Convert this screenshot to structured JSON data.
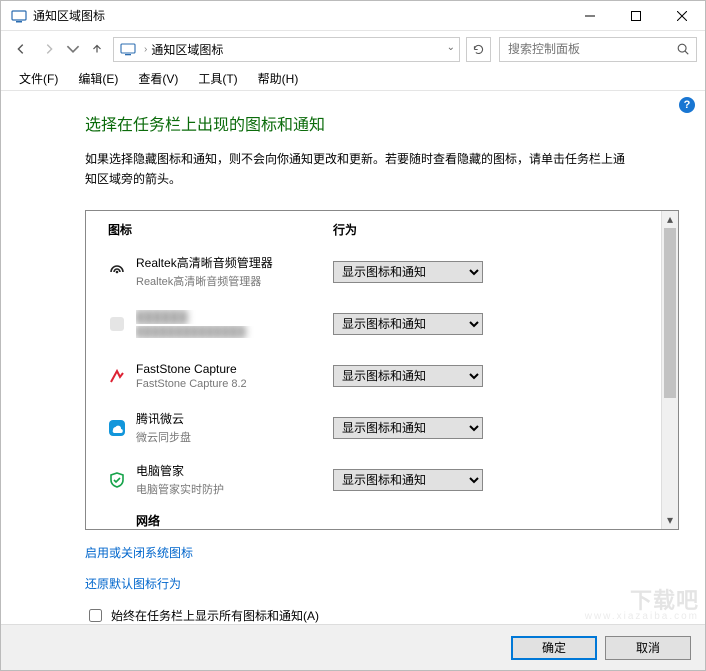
{
  "window": {
    "title": "通知区域图标"
  },
  "nav": {
    "breadcrumb": "通知区域图标",
    "search_placeholder": "搜索控制面板"
  },
  "menu": {
    "file": "文件(F)",
    "edit": "编辑(E)",
    "view": "查看(V)",
    "tools": "工具(T)",
    "help": "帮助(H)"
  },
  "page": {
    "title": "选择在任务栏上出现的图标和通知",
    "description": "如果选择隐藏图标和通知，则不会向你通知更改和更新。若要随时查看隐藏的图标，请单击任务栏上通知区域旁的箭头。"
  },
  "list": {
    "header_icon": "图标",
    "header_behavior": "行为",
    "behavior_option": "显示图标和通知",
    "items": [
      {
        "id": "realtek",
        "name": "Realtek高清晰音频管理器",
        "subtitle": "Realtek高清晰音频管理器",
        "icon_color": "#222",
        "value": "显示图标和通知"
      },
      {
        "id": "redacted",
        "name": "██████",
        "subtitle": "██████████████",
        "icon_color": "#999",
        "value": "显示图标和通知",
        "blur": true
      },
      {
        "id": "faststone",
        "name": "FastStone Capture",
        "subtitle": "FastStone Capture 8.2",
        "icon_color": "#d23",
        "value": "显示图标和通知"
      },
      {
        "id": "weiyun",
        "name": "腾讯微云",
        "subtitle": "微云同步盘",
        "icon_color": "#1296db",
        "value": "显示图标和通知"
      },
      {
        "id": "pcmanager",
        "name": "电脑管家",
        "subtitle": "电脑管家实时防护",
        "icon_color": "#16a34a",
        "value": "显示图标和通知"
      }
    ],
    "partial_next": "网络"
  },
  "links": {
    "system_icons": "启用或关闭系统图标",
    "restore_defaults": "还原默认图标行为"
  },
  "checkbox": {
    "label": "始终在任务栏上显示所有图标和通知(A)",
    "checked": false
  },
  "footer": {
    "ok": "确定",
    "cancel": "取消"
  },
  "watermark": {
    "big": "下载吧",
    "small": "www.xiazaiba.com"
  }
}
